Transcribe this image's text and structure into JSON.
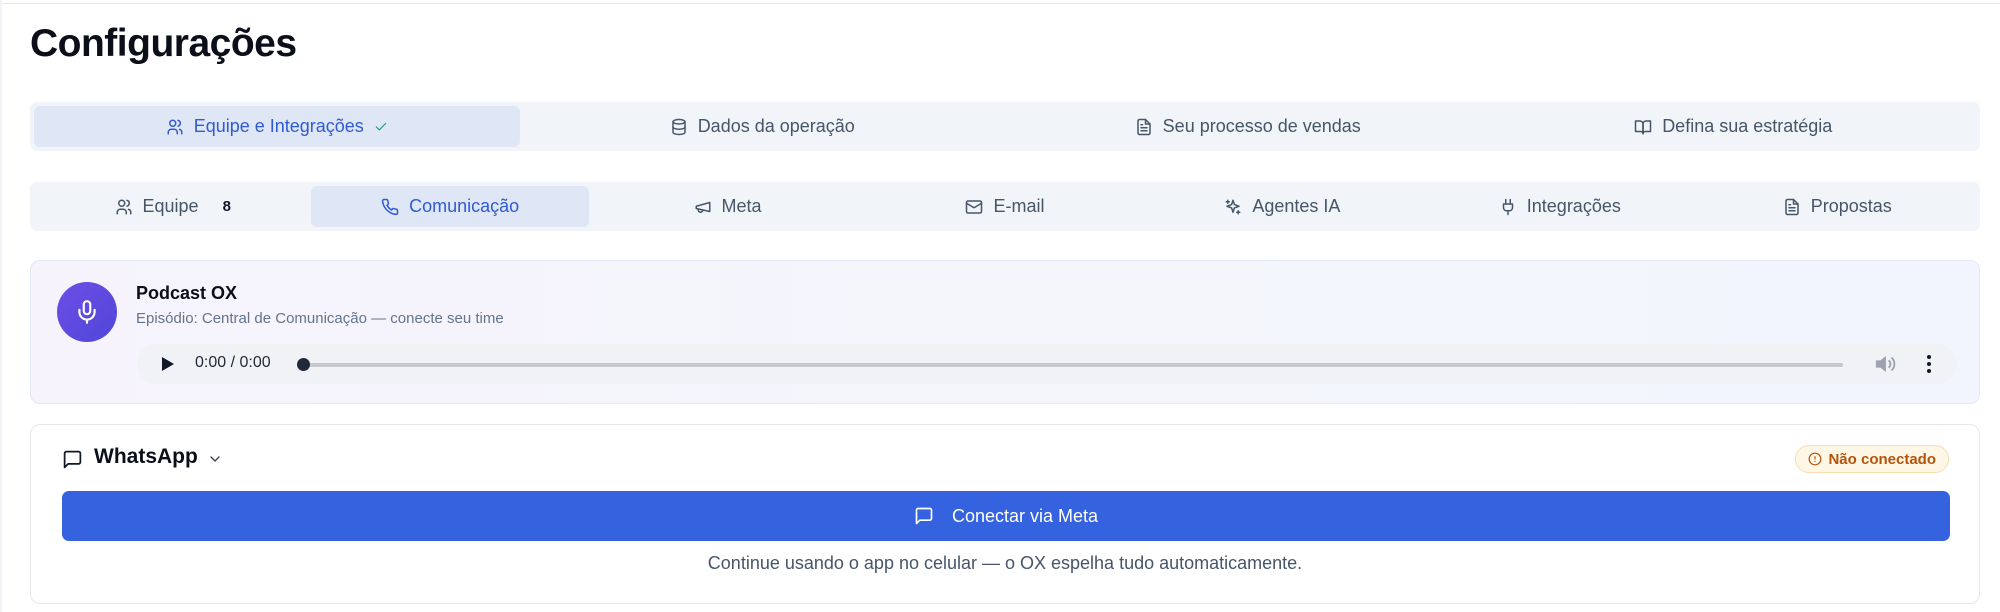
{
  "page": {
    "title": "Configurações"
  },
  "steps": [
    {
      "label": "Equipe e Integrações",
      "icon": "users-icon",
      "active": true,
      "completed": true
    },
    {
      "label": "Dados da operação",
      "icon": "database-icon",
      "active": false
    },
    {
      "label": "Seu processo de vendas",
      "icon": "file-text-icon",
      "active": false
    },
    {
      "label": "Defina sua estratégia",
      "icon": "book-open-icon",
      "active": false
    }
  ],
  "subtabs": [
    {
      "label": "Equipe",
      "icon": "users-icon",
      "count": "8",
      "active": false
    },
    {
      "label": "Comunicação",
      "icon": "phone-icon",
      "active": true
    },
    {
      "label": "Meta",
      "icon": "megaphone-icon",
      "active": false
    },
    {
      "label": "E-mail",
      "icon": "mail-icon",
      "active": false
    },
    {
      "label": "Agentes IA",
      "icon": "sparkles-icon",
      "active": false
    },
    {
      "label": "Integrações",
      "icon": "plug-icon",
      "active": false
    },
    {
      "label": "Propostas",
      "icon": "file-text-icon",
      "active": false
    }
  ],
  "podcast": {
    "title": "Podcast OX",
    "subtitle": "Episódio: Central de Comunicação — conecte seu time",
    "player": {
      "time": "0:00 / 0:00"
    }
  },
  "whatsapp": {
    "title": "WhatsApp",
    "status": "Não conectado",
    "connect_label": "Conectar via Meta",
    "hint": "Continue usando o app no celular — o OX espelha tudo automaticamente."
  },
  "colors": {
    "accent": "#3563e0",
    "active_tab_bg": "#dfe6f6",
    "active_tab_text": "#2f5bd3",
    "warning": "#b45309",
    "podcast_icon": "#5b4ae0"
  }
}
